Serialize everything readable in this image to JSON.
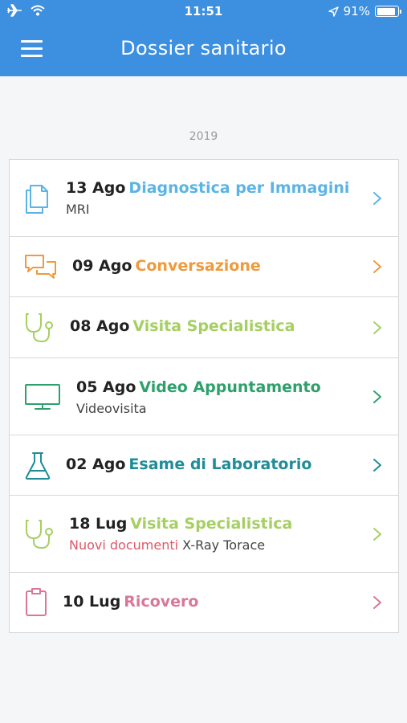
{
  "status_bar": {
    "time": "11:51",
    "battery": "91%",
    "battery_level": 0.91
  },
  "header": {
    "title": "Dossier sanitario"
  },
  "year": "2019",
  "colors": {
    "header": "#3d8fe0",
    "imaging": "#5ab4e5",
    "conversation": "#ef9a3c",
    "specialist": "#a6cf62",
    "video": "#2ea06b",
    "lab": "#1f8d98",
    "admission": "#d8779a",
    "new_docs": "#e0566a"
  },
  "entries": [
    {
      "date": "13 Ago",
      "category": "Diagnostica per Immagini",
      "subtitle": "MRI",
      "icon": "documents-icon"
    },
    {
      "date": "09 Ago",
      "category": "Conversazione",
      "icon": "chat-bubbles-icon"
    },
    {
      "date": "08 Ago",
      "category": "Visita Specialistica",
      "icon": "stethoscope-icon"
    },
    {
      "date": "05 Ago",
      "category": "Video Appuntamento",
      "subtitle": "Videovisita",
      "icon": "monitor-icon"
    },
    {
      "date": "02 Ago",
      "category": "Esame di Laboratorio",
      "icon": "flask-icon"
    },
    {
      "date": "18 Lug",
      "category": "Visita Specialistica",
      "badge": "Nuovi documenti",
      "subtitle": "X-Ray Torace",
      "icon": "stethoscope-icon"
    },
    {
      "date": "10 Lug",
      "category": "Ricovero",
      "icon": "clipboard-icon"
    }
  ]
}
